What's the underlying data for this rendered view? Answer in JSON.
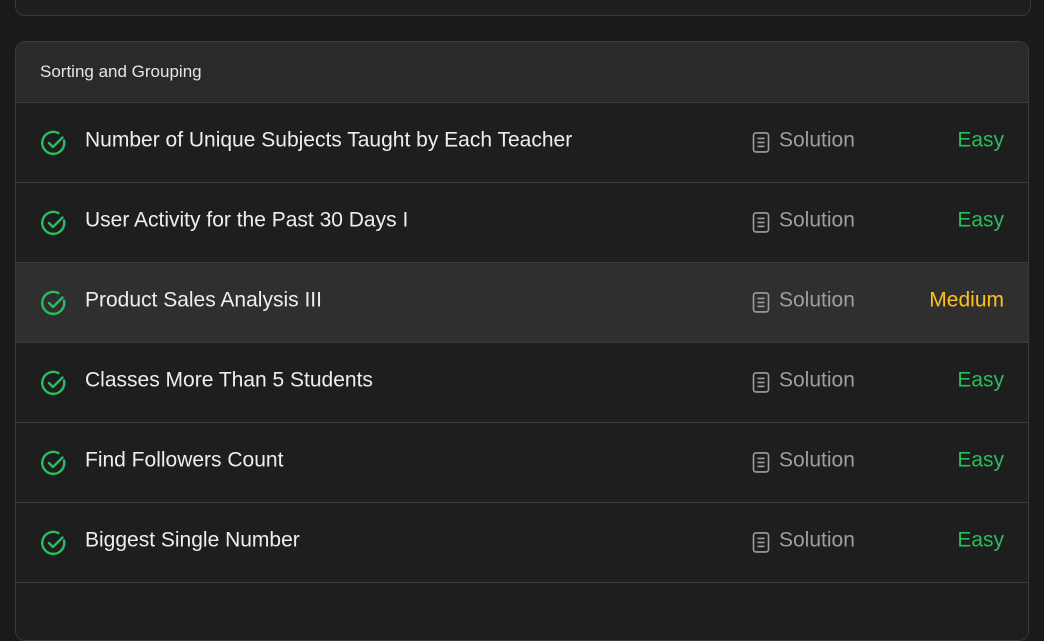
{
  "section": {
    "title": "Sorting and Grouping"
  },
  "problems": [
    {
      "title": "Number of Unique Subjects Taught by Each Teacher",
      "solution_label": "Solution",
      "difficulty": "Easy",
      "solved": true
    },
    {
      "title": "User Activity for the Past 30 Days I",
      "solution_label": "Solution",
      "difficulty": "Easy",
      "solved": true
    },
    {
      "title": "Product Sales Analysis III",
      "solution_label": "Solution",
      "difficulty": "Medium",
      "solved": true
    },
    {
      "title": "Classes More Than 5 Students",
      "solution_label": "Solution",
      "difficulty": "Easy",
      "solved": true
    },
    {
      "title": "Find Followers Count",
      "solution_label": "Solution",
      "difficulty": "Easy",
      "solved": true
    },
    {
      "title": "Biggest Single Number",
      "solution_label": "Solution",
      "difficulty": "Easy",
      "solved": true
    }
  ],
  "colors": {
    "easy": "#2cbb5d",
    "medium": "#ffc01e",
    "solved_check": "#2cbb5d"
  },
  "icons": {
    "solved": "circle-check-icon",
    "solution": "document-icon"
  }
}
